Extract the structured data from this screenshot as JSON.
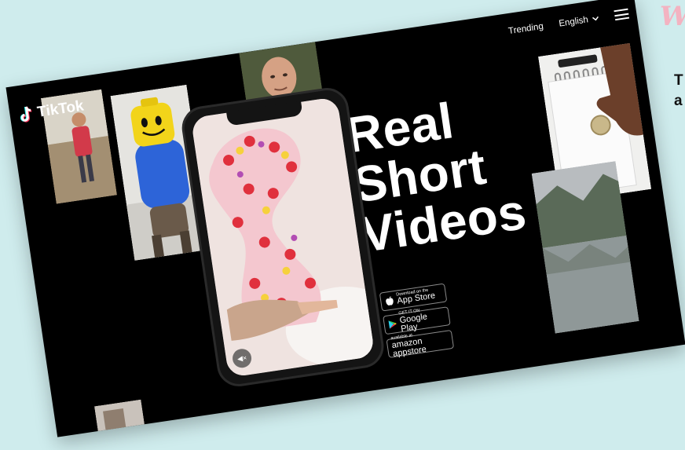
{
  "brand": {
    "name": "TikTok"
  },
  "nav": {
    "trending": "Trending",
    "language": "English"
  },
  "headline": [
    "Real",
    "Short",
    "Videos"
  ],
  "badges": {
    "app_store": {
      "small": "Download on the",
      "big": "App Store"
    },
    "google_play": {
      "small": "GET IT ON",
      "big": "Google Play"
    },
    "amazon": {
      "small": "available at",
      "big": "amazon appstore"
    }
  },
  "page_edge": {
    "word": "W",
    "text": "T\na"
  },
  "icons": [
    "tiktok-logo-icon",
    "chevron-down-icon",
    "hamburger-menu-icon",
    "apple-icon",
    "google-play-icon",
    "mute-icon"
  ],
  "colors": {
    "background": "#cfeced",
    "site_background": "#000000",
    "text": "#ffffff",
    "accent_pink": "#f3b3c1"
  }
}
